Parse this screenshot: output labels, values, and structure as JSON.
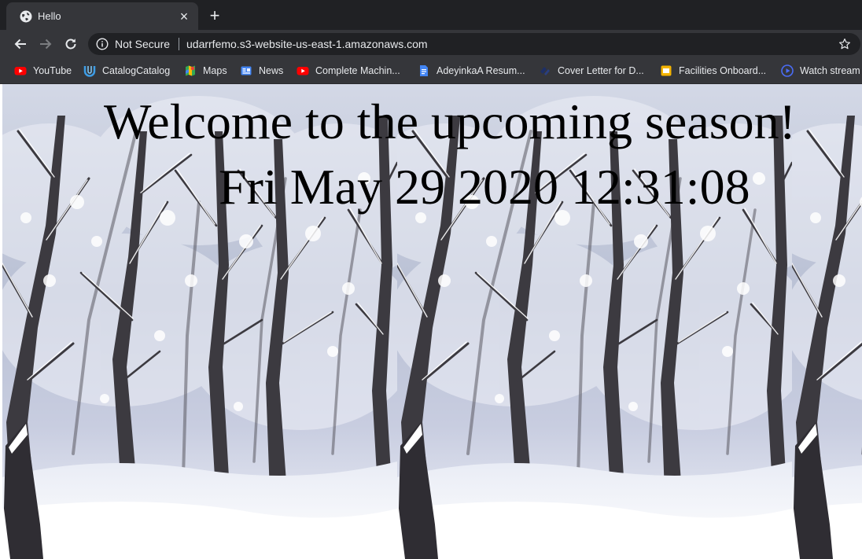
{
  "tab": {
    "title": "Hello",
    "close": "×",
    "new_tab": "+"
  },
  "omnibox": {
    "security": "Not Secure",
    "url": "udarrfemo.s3-website-us-east-1.amazonaws.com"
  },
  "bookmarks": [
    {
      "label": "YouTube",
      "icon": "youtube-icon",
      "color": "#ff0000"
    },
    {
      "label": "CatalogCatalog",
      "icon": "catalog-icon",
      "color": "#3d9ce5"
    },
    {
      "label": "Maps",
      "icon": "maps-icon",
      "color": "#34a853"
    },
    {
      "label": "News",
      "icon": "news-icon",
      "color": "#4285f4"
    },
    {
      "label": "Complete Machin...",
      "icon": "youtube-icon",
      "color": "#ff0000"
    },
    {
      "label": "AdeyinkaA Resum...",
      "icon": "docs-icon",
      "color": "#4285f4"
    },
    {
      "label": "Cover Letter for D...",
      "icon": "bookmark-icon",
      "color": "#1a2a5a"
    },
    {
      "label": "Facilities Onboard...",
      "icon": "slides-icon",
      "color": "#f4b400"
    },
    {
      "label": "Watch stream",
      "icon": "play-icon",
      "color": "#4a6cf7"
    }
  ],
  "page": {
    "heading": "Welcome to the upcoming season!",
    "datetime": "Fri May 29 2020 12:31:08"
  }
}
